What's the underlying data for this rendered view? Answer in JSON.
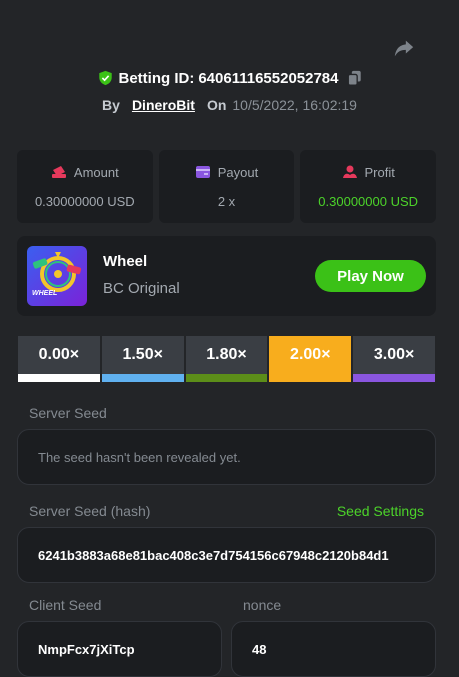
{
  "bet": {
    "betting_id_label": "Betting ID:",
    "betting_id": "64061116552052784",
    "by_label": "By",
    "user": "DineroBit",
    "on_label": "On",
    "date": "10/5/2022, 16:02:19"
  },
  "stats": {
    "amount_label": "Amount",
    "amount_value": "0.30000000 USD",
    "payout_label": "Payout",
    "payout_value": "2 x",
    "profit_label": "Profit",
    "profit_value": "0.30000000 USD"
  },
  "game": {
    "name": "Wheel",
    "subtitle": "BC Original",
    "play_label": "Play Now",
    "thumb_title": "WHEEL"
  },
  "multipliers": [
    {
      "label": "0.00×",
      "color": "#ffffff",
      "active": false
    },
    {
      "label": "1.50×",
      "color": "#60b1f0",
      "active": false
    },
    {
      "label": "1.80×",
      "color": "#5c8e19",
      "active": false
    },
    {
      "label": "2.00×",
      "color": "#f8ad1d",
      "active": true
    },
    {
      "label": "3.00×",
      "color": "#8a56e0",
      "active": false
    }
  ],
  "seeds": {
    "server_seed_label": "Server Seed",
    "server_seed_value": "The seed hasn't been revealed yet.",
    "hash_label": "Server Seed (hash)",
    "seed_settings_label": "Seed Settings",
    "hash_value": "6241b3883a68e81bac408c3e7d754156c67948c2120b84d1",
    "client_seed_label": "Client Seed",
    "client_seed_value": "NmpFcx7jXiTcp",
    "nonce_label": "nonce",
    "nonce_value": "48"
  },
  "colors": {
    "accent_green": "#3bc117",
    "profit_green": "#4cd32a",
    "active_mult": "#f8ad1d"
  }
}
